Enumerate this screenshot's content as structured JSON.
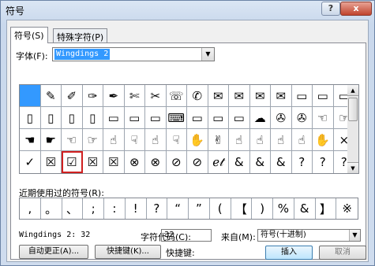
{
  "window": {
    "title": "符号",
    "help_label": "?",
    "close_label": "x"
  },
  "tabs": [
    {
      "label": "符号(S)",
      "active": true
    },
    {
      "label": "特殊字符(P)",
      "active": false
    }
  ],
  "font": {
    "label": "字体(F):",
    "value": "Wingdings 2"
  },
  "symbol_grid": [
    [
      "",
      "✎",
      "✐",
      "✑",
      "✒",
      "✄",
      "✂",
      "☏",
      "✆",
      "✉",
      "✉",
      "✉",
      "✉",
      "▭",
      "▭",
      "▭"
    ],
    [
      "▯",
      "▯",
      "▯",
      "▯",
      "▭",
      "▭",
      "▭",
      "⌨",
      "▭",
      "▭",
      "▭",
      "☁",
      "✇",
      "✇",
      "☜",
      "☞"
    ],
    [
      "☚",
      "☛",
      "☜",
      "☞",
      "☝",
      "☟",
      "☝",
      "☟",
      "✋",
      "✌",
      "☝",
      "☝",
      "☝",
      "☝",
      "✋",
      "×"
    ],
    [
      "✓",
      "☒",
      "☑",
      "☒",
      "☒",
      "⊗",
      "⊗",
      "⊘",
      "⊘",
      "ℯ𝓉",
      "&",
      "&",
      "&",
      "?",
      "?",
      "?"
    ]
  ],
  "selected_symbol": "☑",
  "recent": {
    "label": "近期使用过的符号(R):",
    "symbols": [
      ",",
      "。",
      "、",
      ";",
      ":",
      "!",
      "?",
      "“",
      "”",
      "(",
      "【",
      ")",
      "%",
      "&",
      "】",
      "※"
    ]
  },
  "info": {
    "name_text": "Wingdings 2: 32",
    "code_label": "字符代码(C):",
    "code_value": "32",
    "from_label": "来自(M):",
    "from_value": "符号(十进制)"
  },
  "buttons": {
    "autocorrect": "自动更正(A)...",
    "shortcut_key": "快捷键(K)...",
    "shortcut_label": "快捷键:",
    "insert": "插入",
    "cancel": "取消"
  },
  "colors": {
    "selection": "#3399ff",
    "highlight_box": "#d02020"
  }
}
